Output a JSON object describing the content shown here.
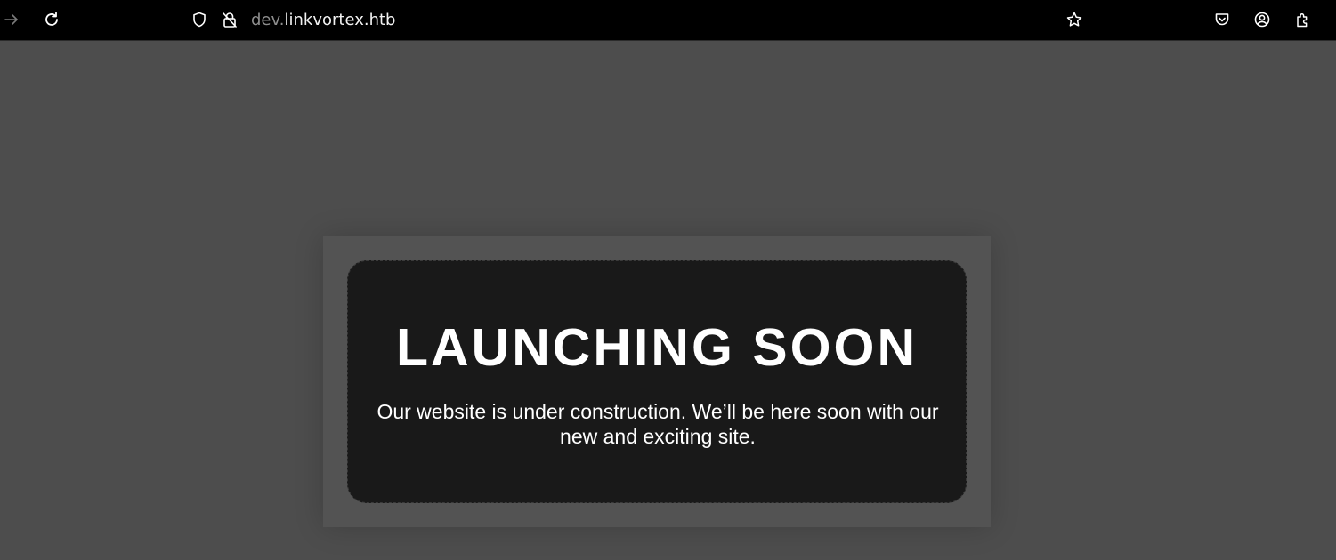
{
  "browser": {
    "url_prefix": "dev.",
    "url_host": "linkvortex.htb",
    "icons": {
      "forward": "forward-arrow-icon",
      "reload": "reload-icon",
      "tracking": "shield-icon",
      "site_info": "lock-icon",
      "bookmark": "star-icon",
      "pocket": "pocket-icon",
      "account": "account-icon",
      "extensions": "extensions-icon"
    }
  },
  "page": {
    "headline": "LAUNCHING SOON",
    "tagline": "Our website is under construction. We’ll be here soon with our new and exciting site."
  },
  "colors": {
    "toolbar_bg": "#000000",
    "page_bg": "#4d4d4d",
    "card_bg": "#191919",
    "text": "#ffffff"
  }
}
